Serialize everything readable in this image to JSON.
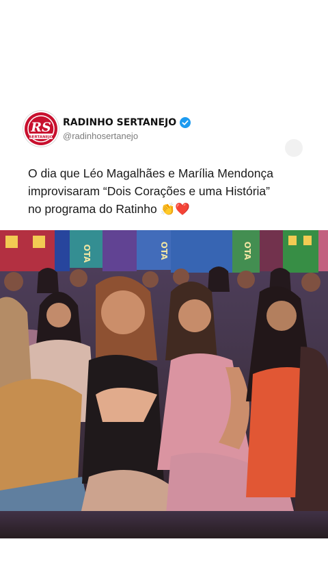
{
  "post": {
    "author": {
      "display_name": "RADINHO SERTANEJO",
      "handle": "@radinhosertanejo",
      "verified": true,
      "avatar": {
        "logo_text": "RS",
        "logo_subtext": "SERTANEJO"
      },
      "verified_icon": "verified-badge-icon"
    },
    "text_lines": [
      "O dia que Léo Magalhães e Marília Mendonça",
      "improvisaram “Dois Corações e uma História”",
      "no programa do Ratinho 👏❤️"
    ],
    "media": {
      "kind": "video-still",
      "description_icon": "audience-photo",
      "sign_letters": [
        "OTA",
        "OTA",
        "OTA"
      ]
    }
  },
  "colors": {
    "brand_red": "#c8102e",
    "verified_blue": "#1d9bf0",
    "text": "#1a1a1a",
    "muted": "#7b7b7b"
  }
}
